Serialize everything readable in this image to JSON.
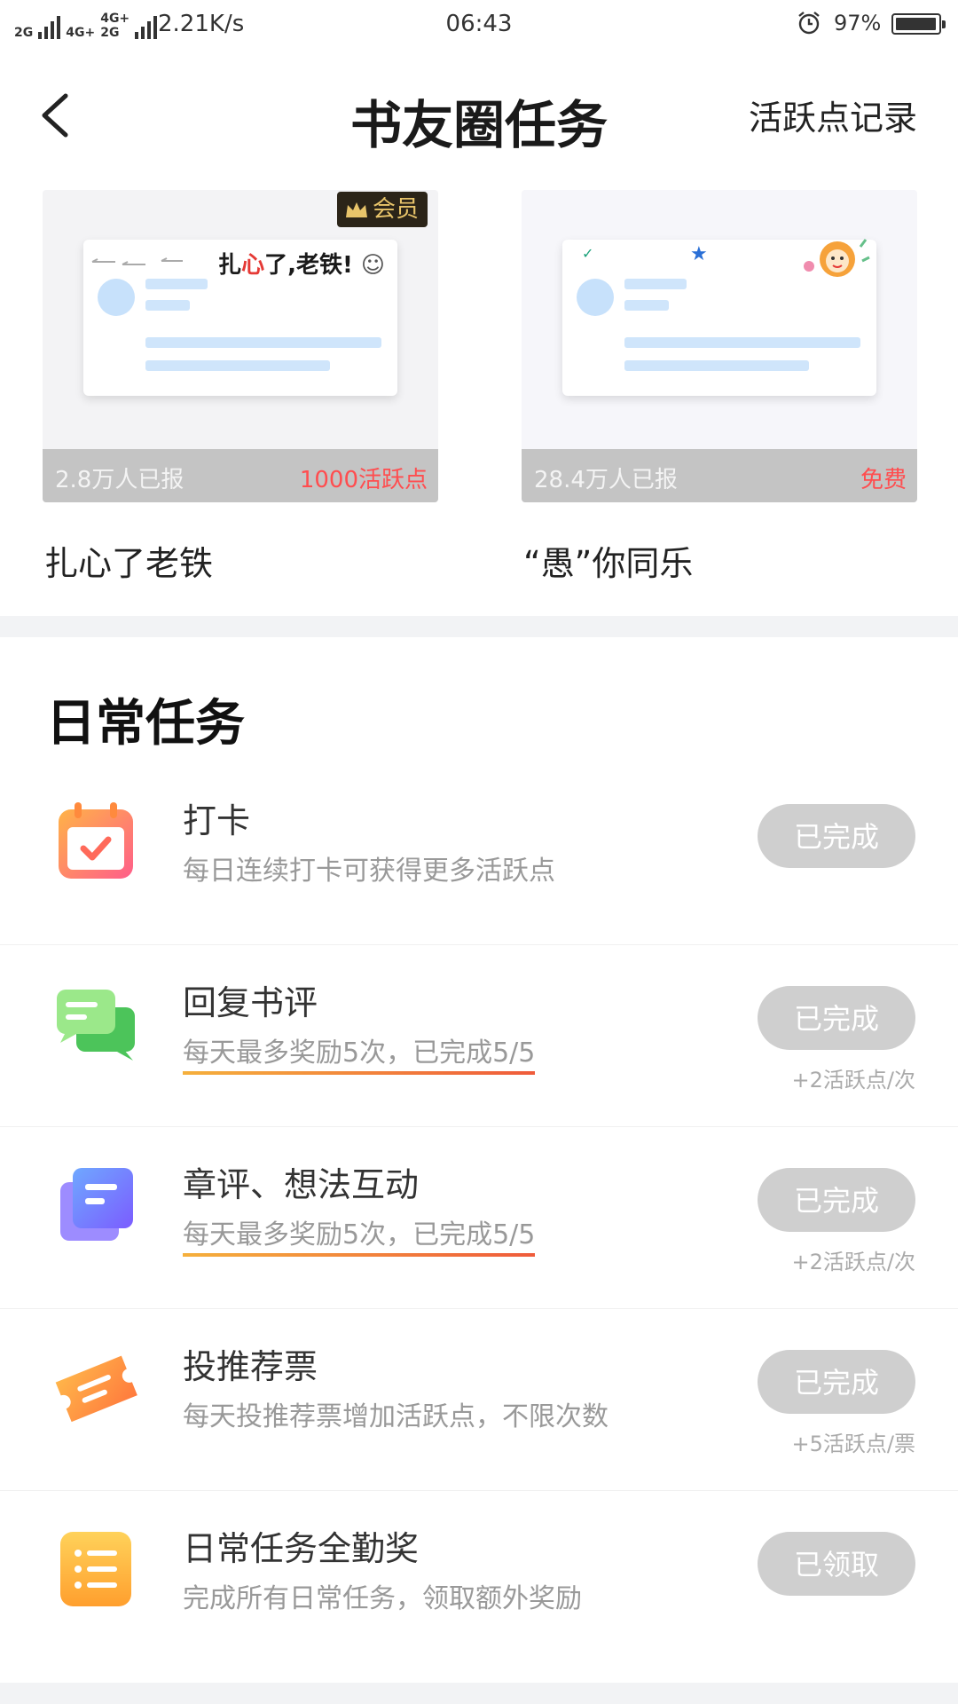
{
  "status_bar": {
    "network_a": "2G",
    "network_b": "4G+",
    "network_c": "4G+",
    "network_d": "2G",
    "speed": "2.21K/s",
    "time": "06:43",
    "battery_percent": "97%",
    "battery_level": 0.97
  },
  "header": {
    "title": "书友圈任务",
    "record_link": "活跃点记录"
  },
  "featured": [
    {
      "title": "扎心了老铁",
      "participants": "2.8万人已报",
      "price": "1000活跃点",
      "badge": "会员",
      "sticker_text_prefix": "扎",
      "sticker_text_red": "心",
      "sticker_text_suffix": "了,老铁!"
    },
    {
      "title": "“愚”你同乐",
      "participants": "28.4万人已报",
      "price": "免费"
    }
  ],
  "daily": {
    "title": "日常任务",
    "tasks": [
      {
        "icon": "calendar-check-icon",
        "name": "打卡",
        "desc": "每日连续打卡可获得更多活跃点",
        "button": "已完成",
        "reward": ""
      },
      {
        "icon": "chat-bubbles-icon",
        "name": "回复书评",
        "desc": "每天最多奖励5次，已完成5/5",
        "button": "已完成",
        "reward": "+2活跃点/次"
      },
      {
        "icon": "document-stack-icon",
        "name": "章评、想法互动",
        "desc": "每天最多奖励5次，已完成5/5",
        "button": "已完成",
        "reward": "+2活跃点/次"
      },
      {
        "icon": "ticket-icon",
        "name": "投推荐票",
        "desc": "每天投推荐票增加活跃点，不限次数",
        "button": "已完成",
        "reward": "+5活跃点/票"
      },
      {
        "icon": "list-icon",
        "name": "日常任务全勤奖",
        "desc": "完成所有日常任务，领取额外奖励",
        "button": "已领取",
        "reward": ""
      }
    ]
  },
  "colors": {
    "accent_red": "#ff4d4f",
    "button_gray": "#cfcfcf",
    "underline_start": "#f5b03c",
    "underline_end": "#ef5b3b"
  }
}
